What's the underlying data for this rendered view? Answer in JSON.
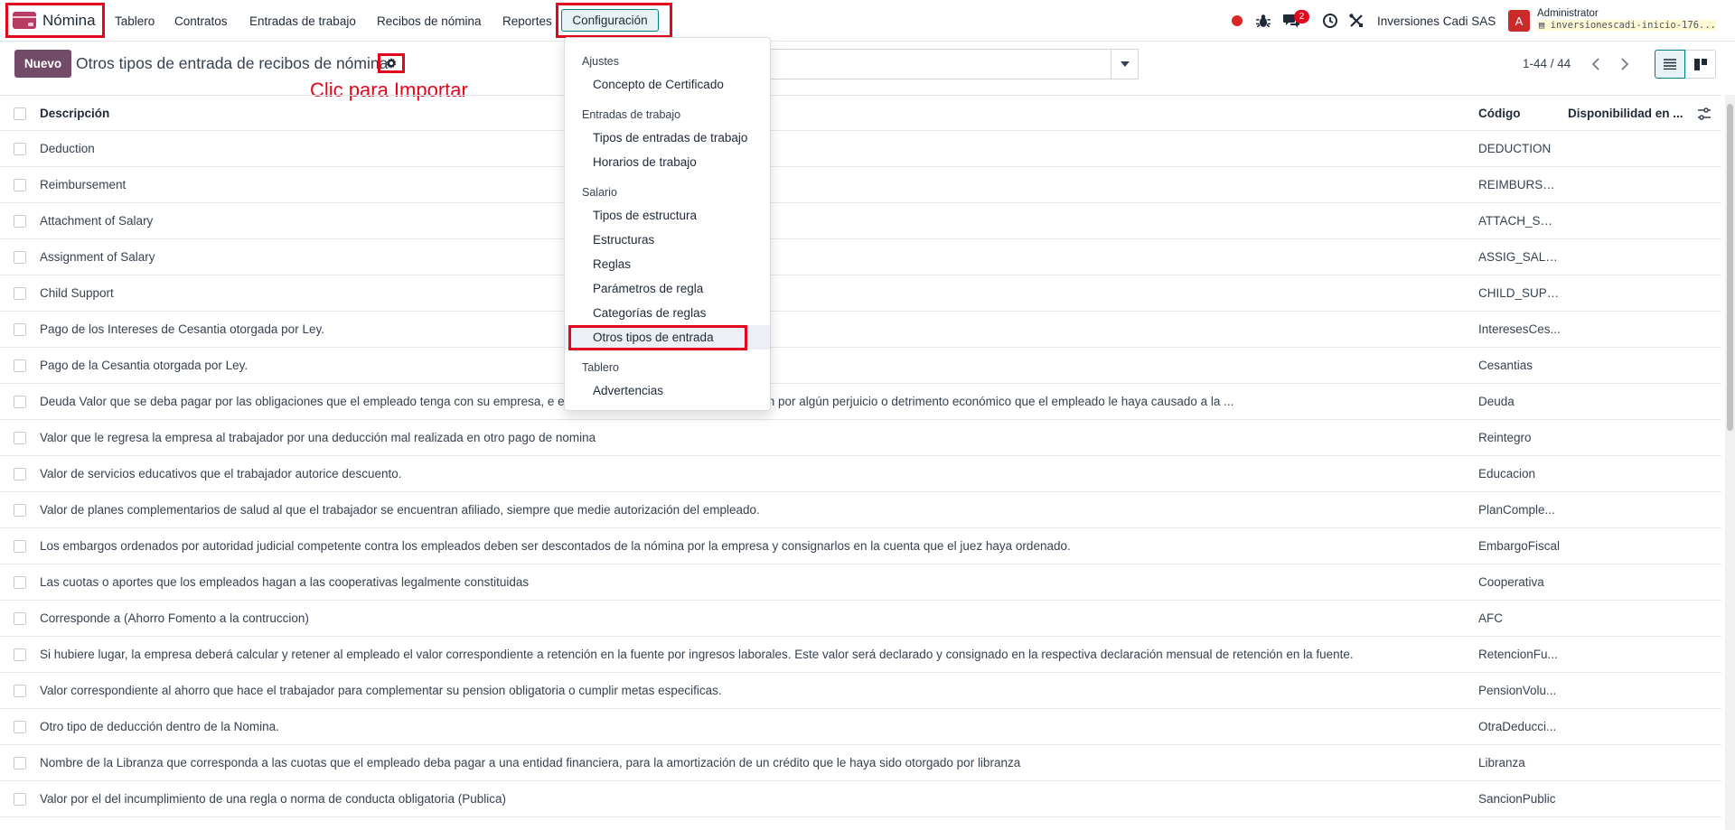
{
  "navbar": {
    "app_name": "Nómina",
    "menu": [
      "Tablero",
      "Contratos",
      "Entradas de trabajo",
      "Recibos de nómina",
      "Reportes",
      "Configuración"
    ],
    "chat_count": "2",
    "company": "Inversiones Cadi SAS",
    "avatar_letter": "A",
    "user_name": "Administrator",
    "database": "inversionescadi-inicio-176..."
  },
  "control_panel": {
    "new_button": "Nuevo",
    "title": "Otros tipos de entrada de recibos de nómina",
    "annotation": "Clic para Importar",
    "pager": "1-44 / 44"
  },
  "config_menu": {
    "sections": [
      {
        "title": "Ajustes",
        "items": [
          "Concepto de Certificado"
        ]
      },
      {
        "title": "Entradas de trabajo",
        "items": [
          "Tipos de entradas de trabajo",
          "Horarios de trabajo"
        ]
      },
      {
        "title": "Salario",
        "items": [
          "Tipos de estructura",
          "Estructuras",
          "Reglas",
          "Parámetros de regla",
          "Categorías de reglas",
          "Otros tipos de entrada"
        ]
      },
      {
        "title": "Tablero",
        "items": [
          "Advertencias"
        ]
      }
    ],
    "active_item": "Otros tipos de entrada"
  },
  "table": {
    "columns": [
      "Descripción",
      "Código",
      "Disponibilidad en ..."
    ],
    "rows": [
      {
        "description": "Deduction",
        "code": "DEDUCTION"
      },
      {
        "description": "Reimbursement",
        "code": "REIMBURSE..."
      },
      {
        "description": "Attachment of Salary",
        "code": "ATTACH_SAL..."
      },
      {
        "description": "Assignment of Salary",
        "code": "ASSIG_SALA..."
      },
      {
        "description": "Child Support",
        "code": "CHILD_SUPP..."
      },
      {
        "description": "Pago de los Intereses de Cesantia otorgada por Ley.",
        "code": "InteresesCes..."
      },
      {
        "description": "Pago de la Cesantia otorgada por Ley.",
        "code": "Cesantias"
      },
      {
        "description": "Deuda Valor que se deba pagar por las obligaciones que el empleado tenga con su empresa, e                                                               e haya otorgado, o como compensación por algún perjuicio o detrimento económico que el empleado le haya causado a la ...",
        "code": "Deuda"
      },
      {
        "description": "Valor que le regresa la empresa al trabajador por una deducción mal realizada en otro pago de nomina",
        "code": "Reintegro"
      },
      {
        "description": "Valor de servicios educativos que el trabajador autorice descuento.",
        "code": "Educacion"
      },
      {
        "description": "Valor de planes complementarios de salud al que el trabajador se encuentran afiliado, siempre que medie autorización del empleado.",
        "code": "PlanComple..."
      },
      {
        "description": "Los embargos ordenados por autoridad judicial competente contra los empleados deben ser descontados de la nómina por la empresa y consignarlos en la cuenta que el juez haya ordenado.",
        "code": "EmbargoFiscal"
      },
      {
        "description": "Las cuotas o aportes que los empleados hagan a las cooperativas legalmente constituidas",
        "code": "Cooperativa"
      },
      {
        "description": "Corresponde a (Ahorro Fomento a la contruccion)",
        "code": "AFC"
      },
      {
        "description": "Si hubiere lugar, la empresa deberá calcular y retener al empleado el valor correspondiente a retención en la fuente por ingresos laborales. Este valor será declarado y consignado en la respectiva declaración mensual de retención en la fuente.",
        "code": "RetencionFu..."
      },
      {
        "description": "Valor correspondiente al ahorro que hace el trabajador para complementar su pension obligatoria o cumplir metas especificas.",
        "code": "PensionVolu..."
      },
      {
        "description": "Otro tipo de deducción dentro de la Nomina.",
        "code": "OtraDeducci..."
      },
      {
        "description": "Nombre de la Libranza que corresponda a las cuotas que el empleado deba pagar a una entidad financiera, para la amortización de un crédito que le haya sido otorgado por libranza",
        "code": "Libranza"
      },
      {
        "description": "Valor por el del incumplimiento de una regla o norma de conducta obligatoria (Publica)",
        "code": "SancionPublic"
      }
    ]
  },
  "colors": {
    "brand": "#714b67",
    "accent": "#017e84",
    "highlight": "#e3061c"
  }
}
